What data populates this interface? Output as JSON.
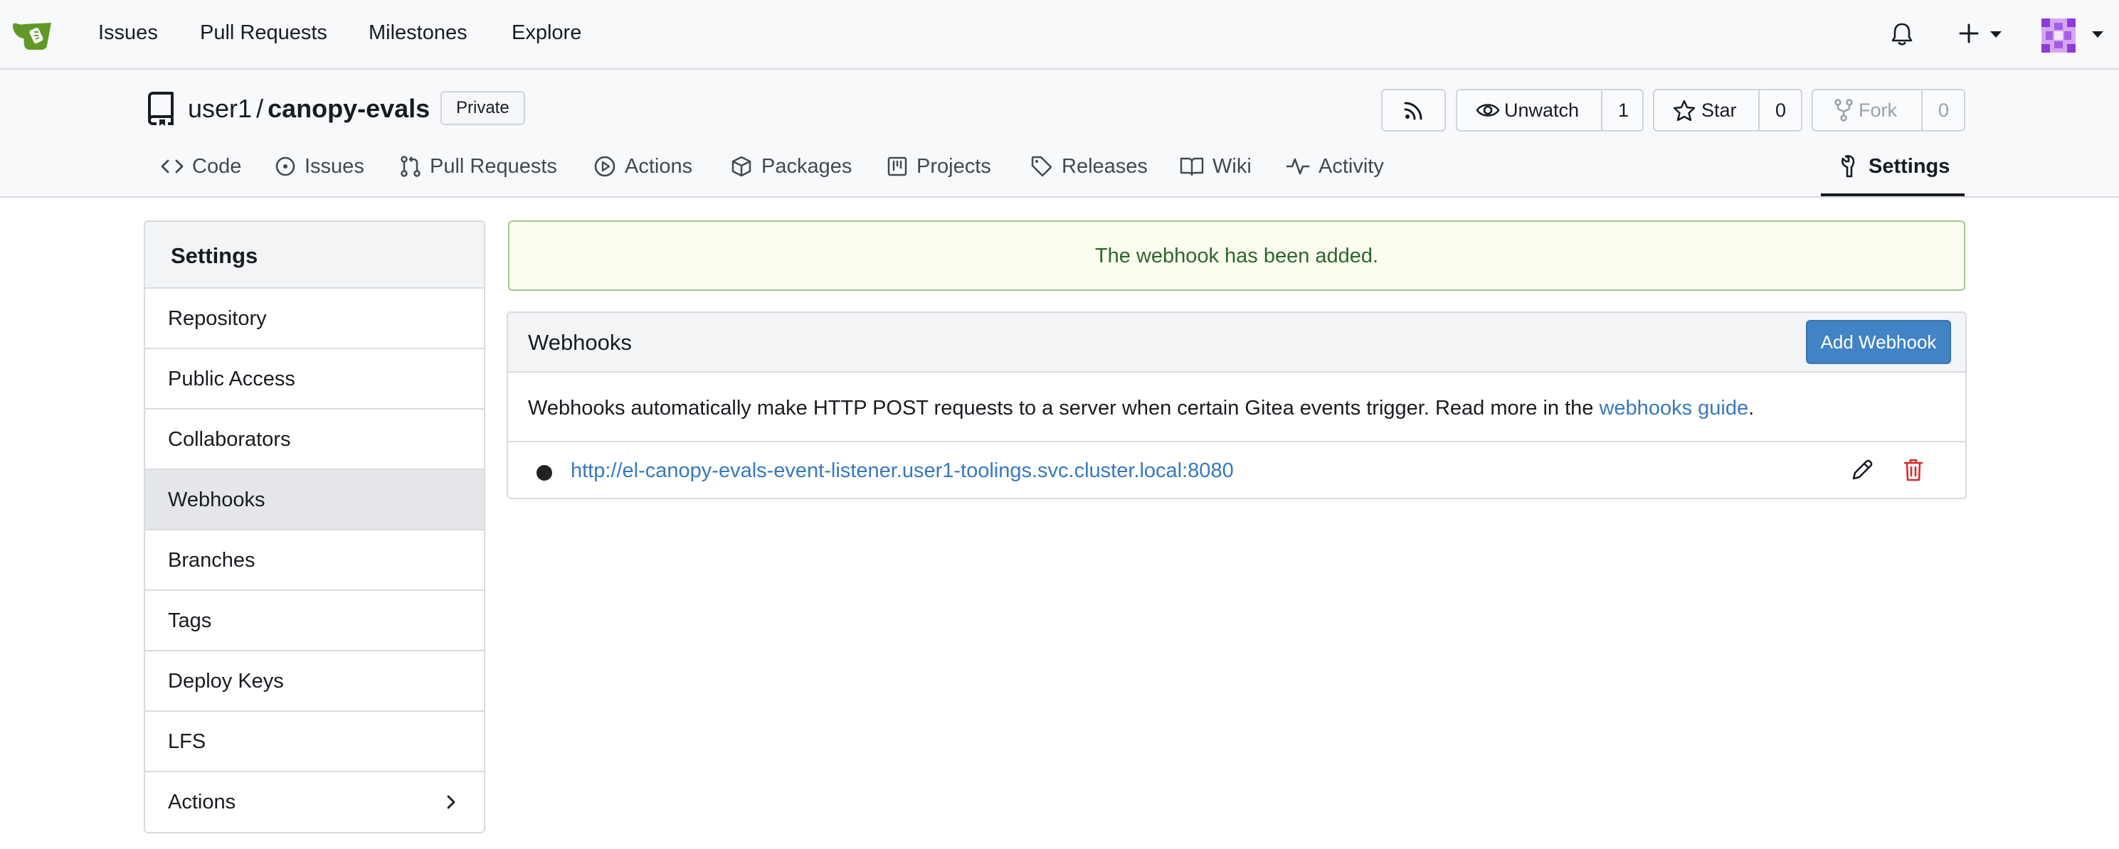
{
  "navbar": {
    "items": [
      "Issues",
      "Pull Requests",
      "Milestones",
      "Explore"
    ]
  },
  "repo": {
    "owner": "user1",
    "separator": "/",
    "name": "canopy-evals",
    "visibility": "Private",
    "watch_label": "Unwatch",
    "watch_count": "1",
    "star_label": "Star",
    "star_count": "0",
    "fork_label": "Fork",
    "fork_count": "0"
  },
  "tabs": {
    "code": "Code",
    "issues": "Issues",
    "pulls": "Pull Requests",
    "actions": "Actions",
    "packages": "Packages",
    "projects": "Projects",
    "releases": "Releases",
    "wiki": "Wiki",
    "activity": "Activity",
    "settings": "Settings"
  },
  "sidebar": {
    "title": "Settings",
    "items": [
      "Repository",
      "Public Access",
      "Collaborators",
      "Webhooks",
      "Branches",
      "Tags",
      "Deploy Keys",
      "LFS",
      "Actions"
    ],
    "active": "Webhooks"
  },
  "flash": {
    "message": "The webhook has been added."
  },
  "webhooks": {
    "title": "Webhooks",
    "add_button": "Add Webhook",
    "description": "Webhooks automatically make HTTP POST requests to a server when certain Gitea events trigger. Read more in the ",
    "guide_link": "webhooks guide",
    "description_end": ".",
    "hooks": [
      {
        "url": "http://el-canopy-evals-event-listener.user1-toolings.svc.cluster.local:8080"
      }
    ]
  },
  "colors": {
    "accent": "#4183c4",
    "link": "#3679bd",
    "success_text": "#2c662d",
    "success_border": "#a6c98c",
    "danger": "#db2828",
    "logo_green": "#609926"
  }
}
